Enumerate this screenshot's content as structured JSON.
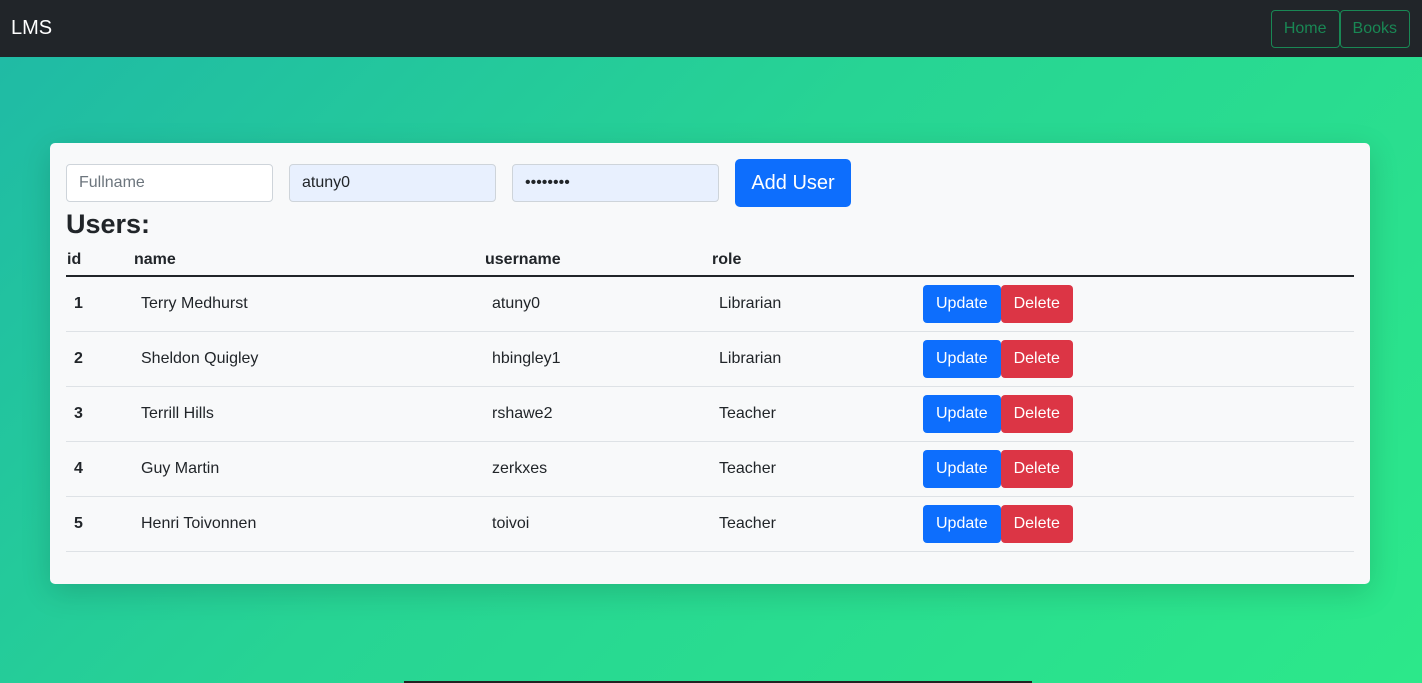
{
  "navbar": {
    "brand": "LMS",
    "home_label": "Home",
    "books_label": "Books"
  },
  "form": {
    "fullname_placeholder": "Fullname",
    "username_value": "atuny0",
    "password_value": "••••••••",
    "add_label": "Add User"
  },
  "heading": "Users:",
  "table": {
    "headers": {
      "id": "id",
      "name": "name",
      "username": "username",
      "role": "role"
    },
    "rows": [
      {
        "id": "1",
        "name": "Terry Medhurst",
        "username": "atuny0",
        "role": "Librarian"
      },
      {
        "id": "2",
        "name": "Sheldon Quigley",
        "username": "hbingley1",
        "role": "Librarian"
      },
      {
        "id": "3",
        "name": "Terrill Hills",
        "username": "rshawe2",
        "role": "Teacher"
      },
      {
        "id": "4",
        "name": "Guy Martin",
        "username": "zerkxes",
        "role": "Teacher"
      },
      {
        "id": "5",
        "name": "Henri Toivonnen",
        "username": "toivoi",
        "role": "Teacher"
      }
    ],
    "update_label": "Update",
    "delete_label": "Delete"
  }
}
